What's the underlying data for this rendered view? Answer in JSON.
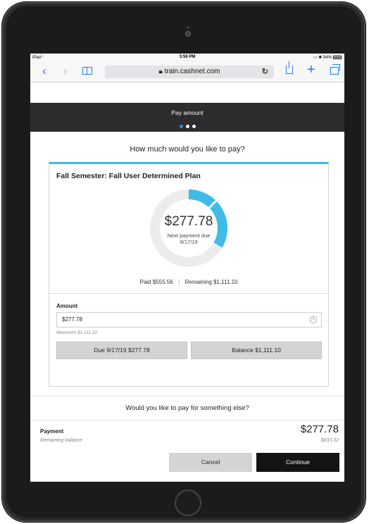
{
  "status_bar": {
    "carrier": "iPad",
    "time": "3:56 PM",
    "battery": "94%"
  },
  "browser": {
    "url": "train.cashnet.com",
    "icons": [
      "back-icon",
      "forward-icon",
      "bookmarks-icon",
      "lock-icon",
      "reload-icon",
      "share-icon",
      "add-tab-icon",
      "tabs-icon"
    ]
  },
  "step": {
    "label": "Pay amount",
    "total": 3,
    "current": 1
  },
  "question": "How much would you like to pay?",
  "plan": {
    "title": "Fall Semester: Fall User Determined Plan",
    "amount": "$277.78",
    "next_payment_label": "Next payment due",
    "next_payment_date": "9/17/19",
    "paid": "Paid $555.56",
    "remaining": "Remaining $1,111.10",
    "progress_paid_fraction": 0.333
  },
  "amount_field": {
    "label": "Amount",
    "value": "$277.78",
    "maximum": "Maximum $1,111.10"
  },
  "quick_buttons": {
    "due": "Due 9/17/19 $277.78",
    "balance": "Balance $1,111.10"
  },
  "else_prompt": "Would you like to pay for something else?",
  "footer": {
    "payment_label": "Payment",
    "payment_amount": "$277.78",
    "remaining_label": "Remaining balance",
    "remaining_amount": "$833.32",
    "cancel": "Cancel",
    "continue": "Continue"
  },
  "colors": {
    "accent": "#3fbbe6",
    "dark": "#2c2c2e",
    "active_dot": "#3d8bd8"
  }
}
